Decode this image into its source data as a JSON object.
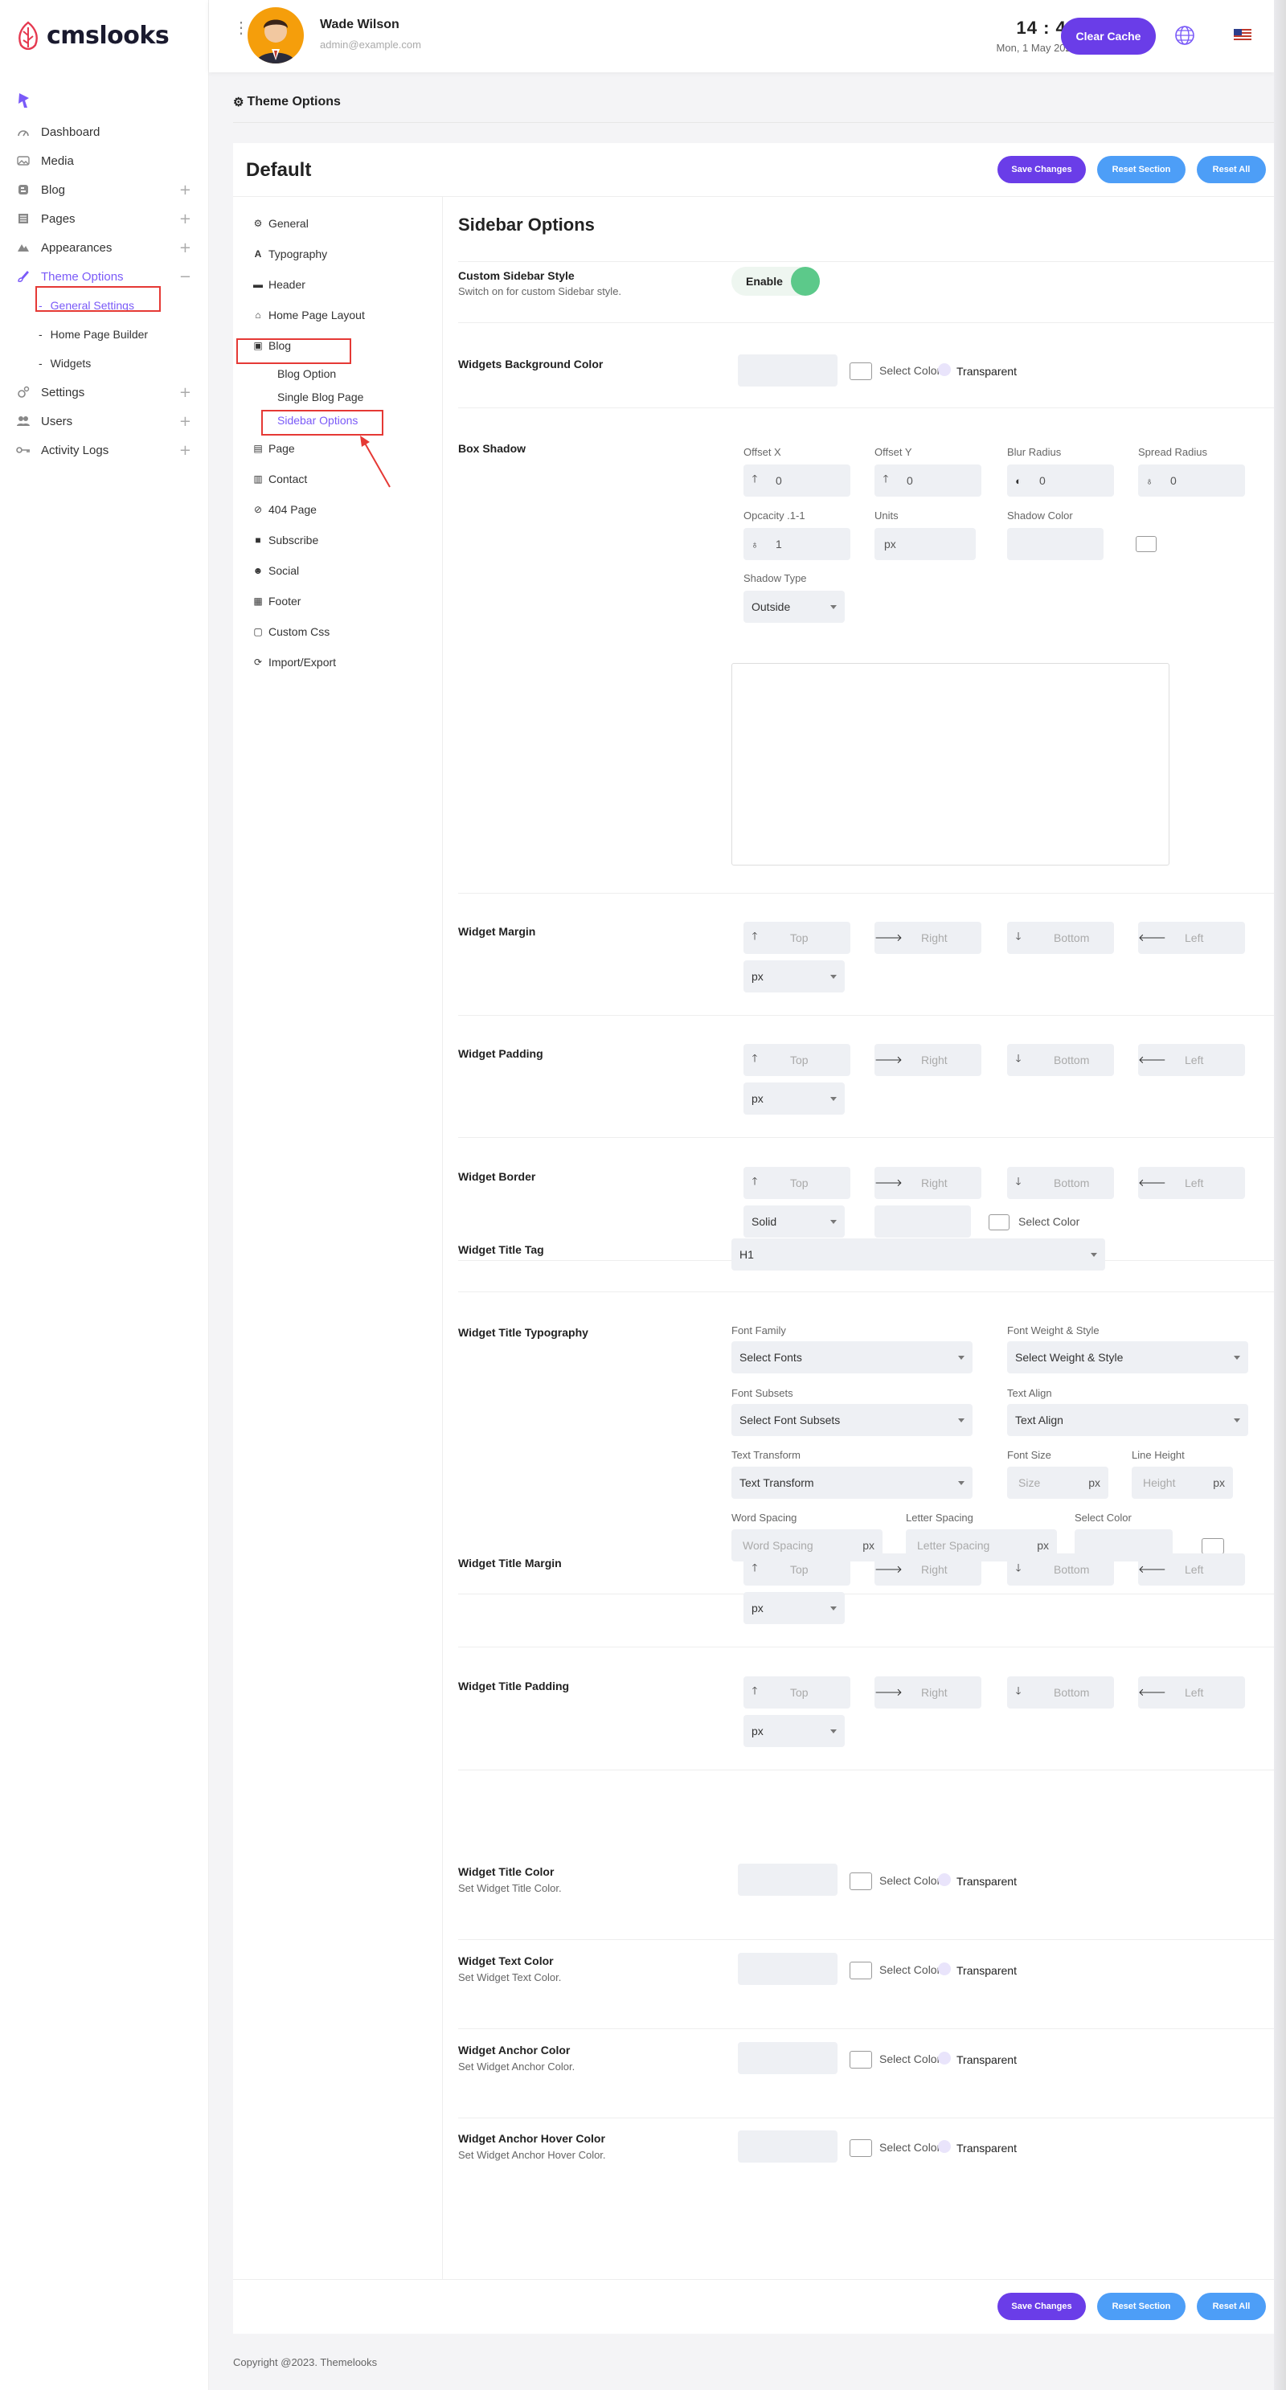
{
  "app": {
    "brand": "cmslooks",
    "accent": "#7a5af8"
  },
  "sidebar": {
    "items": [
      {
        "label": "Dashboard",
        "icon": "gauge-icon",
        "plus": false
      },
      {
        "label": "Media",
        "icon": "image-icon",
        "plus": false
      },
      {
        "label": "Blog",
        "icon": "blog-icon",
        "plus": true
      },
      {
        "label": "Pages",
        "icon": "pages-icon",
        "plus": true
      },
      {
        "label": "Appearances",
        "icon": "appearance-icon",
        "plus": true
      },
      {
        "label": "Theme Options",
        "icon": "brush-icon",
        "plus": true,
        "minus": "−",
        "active": true
      }
    ],
    "sub": [
      "General Settings",
      "Home Page Builder",
      "Widgets"
    ],
    "sub_dash": "-",
    "plus_symbol": "+",
    "items2": [
      {
        "label": "Settings",
        "icon": "gear-icon"
      },
      {
        "label": "Users",
        "icon": "users-icon"
      },
      {
        "label": "Activity Logs",
        "icon": "key-icon"
      }
    ]
  },
  "topbar": {
    "user_name": "Wade Wilson",
    "user_email": "admin@example.com",
    "time": "14 : 43",
    "date": "Mon, 1 May 2023",
    "clear_cache": "Clear Cache"
  },
  "page": {
    "title": "Theme Options",
    "card_title": "Default",
    "save": "Save Changes",
    "reset_section": "Reset Section",
    "reset_all": "Reset All",
    "copyright": "Copyright @2023. Themelooks"
  },
  "leftnav": {
    "items": [
      "General",
      "Typography",
      "Header",
      "Home Page Layout",
      "Blog"
    ],
    "blog_sub": [
      "Blog Option",
      "Single Blog Page",
      "Sidebar Options"
    ],
    "items2": [
      "Page",
      "Contact",
      "404 Page",
      "Subscribe",
      "Social",
      "Footer",
      "Custom Css",
      "Import/Export"
    ]
  },
  "form": {
    "section_title": "Sidebar Options",
    "custom_style": {
      "label": "Custom Sidebar Style",
      "desc": "Switch on for custom Sidebar style.",
      "toggle": "Enable"
    },
    "widgets_bg": {
      "label": "Widgets Background Color"
    },
    "select_color": "Select Color",
    "transparent": "Transparent",
    "box_shadow": {
      "label": "Box Shadow",
      "offset_x": "Offset X",
      "offset_y": "Offset Y",
      "blur": "Blur Radius",
      "spread": "Spread Radius",
      "opacity": "Opcacity .1-1",
      "units": "Units",
      "shadow_color": "Shadow Color",
      "shadow_type": "Shadow Type",
      "zero": "0",
      "one": "1",
      "px": "px",
      "outside": "Outside"
    },
    "sides": {
      "top": "Top",
      "right": "Right",
      "bottom": "Bottom",
      "left": "Left"
    },
    "widget_margin": "Widget Margin",
    "widget_padding": "Widget Padding",
    "widget_border": "Widget Border",
    "solid": "Solid",
    "title_tag": {
      "label": "Widget Title Tag",
      "value": "H1"
    },
    "typo": {
      "label": "Widget Title Typography",
      "font_family": "Font Family",
      "select_fonts": "Select Fonts",
      "weight": "Font Weight & Style",
      "select_weight": "Select Weight & Style",
      "subsets": "Font Subsets",
      "select_subsets": "Select Font Subsets",
      "align": "Text Align",
      "align_val": "Text Align",
      "transform": "Text Transform",
      "transform_val": "Text Transform",
      "font_size": "Font Size",
      "size_ph": "Size",
      "line_height": "Line Height",
      "height_ph": "Height",
      "word_spacing": "Word Spacing",
      "word_ph": "Word Spacing",
      "letter_spacing": "Letter Spacing",
      "letter_ph": "Letter Spacing",
      "select_color": "Select Color"
    },
    "title_margin": "Widget Title Margin",
    "title_padding": "Widget Title Padding",
    "colors": [
      {
        "label": "Widget Title Color",
        "desc": "Set Widget Title Color."
      },
      {
        "label": "Widget Text Color",
        "desc": "Set Widget Text Color."
      },
      {
        "label": "Widget Anchor Color",
        "desc": "Set Widget Anchor Color."
      },
      {
        "label": "Widget Anchor Hover Color",
        "desc": "Set Widget Anchor Hover Color."
      }
    ]
  }
}
